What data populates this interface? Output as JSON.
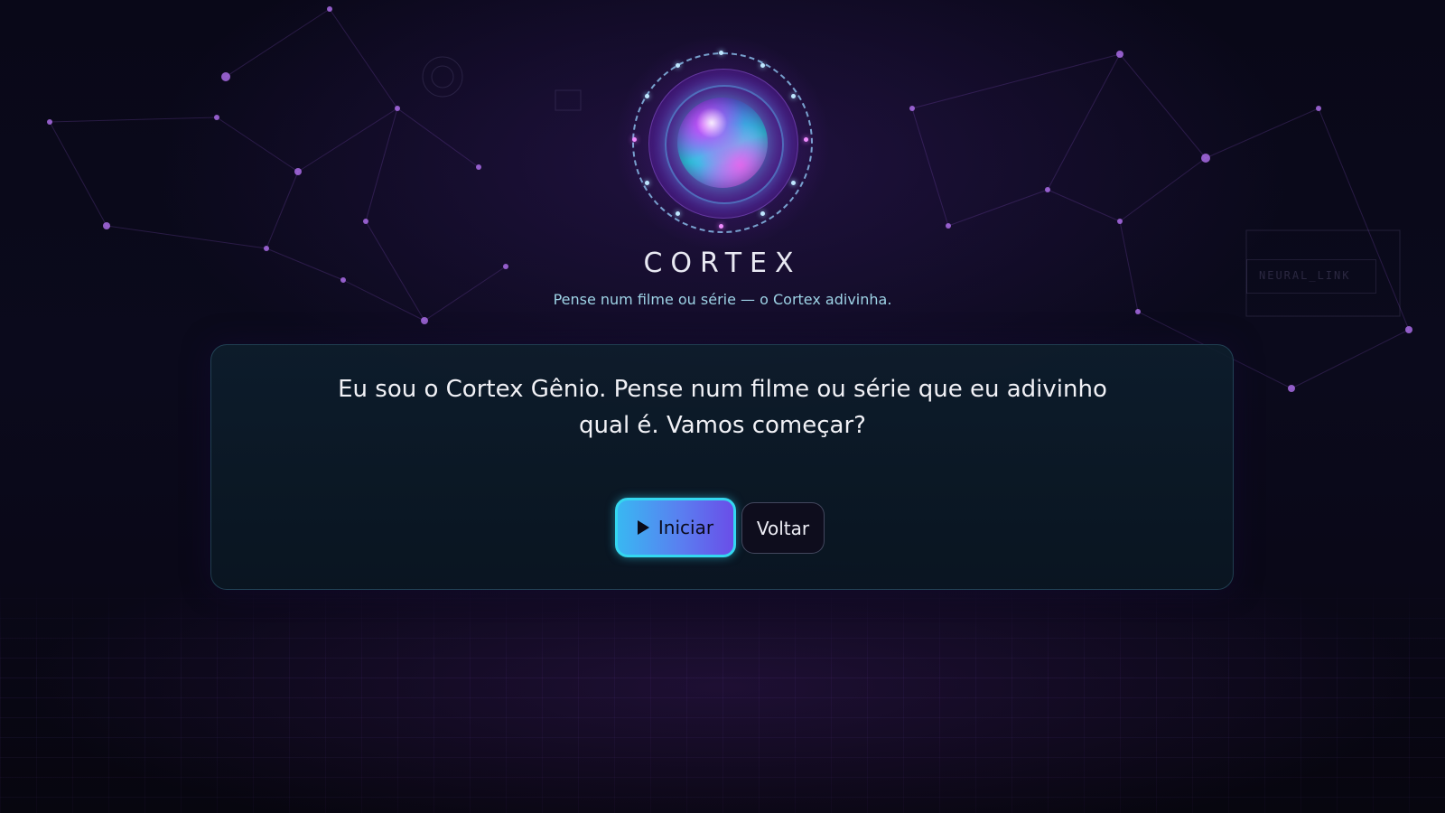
{
  "brand": {
    "title": "CORTEX",
    "subtitle": "Pense num filme ou série — o Cortex adivinha."
  },
  "card": {
    "message": "Eu sou o Cortex Gênio. Pense num filme ou série que eu adivinho qual é. Vamos começar?"
  },
  "actions": {
    "start_label": "Iniciar",
    "start_icon": "play-icon",
    "back_label": "Voltar"
  },
  "background": {
    "labels": [
      "NEURAL_LINK"
    ]
  },
  "colors": {
    "background": "#070612",
    "accent_cyan": "#34d7f0",
    "accent_violet": "#6a4ee8",
    "subtitle": "#9ed3e6",
    "card_bg": "#0e1e2c"
  }
}
